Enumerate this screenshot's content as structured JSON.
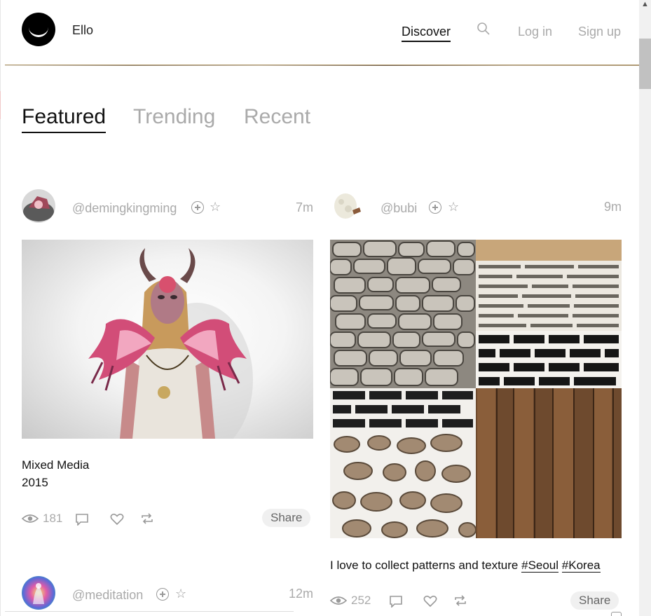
{
  "header": {
    "brand": "Ello",
    "nav": {
      "discover": "Discover",
      "login": "Log in",
      "signup": "Sign up"
    }
  },
  "tabs": [
    {
      "label": "Featured",
      "active": true
    },
    {
      "label": "Trending",
      "active": false
    },
    {
      "label": "Recent",
      "active": false
    }
  ],
  "posts": [
    {
      "username": "@demingkingming",
      "time": "7m",
      "text_lines": [
        "Mixed Media",
        "2015"
      ],
      "views": "181",
      "share": "Share"
    },
    {
      "username": "@bubi",
      "time": "9m",
      "text": "I love to collect patterns and texture",
      "tags": [
        "#Seoul",
        "#Korea"
      ],
      "views": "252",
      "share": "Share"
    },
    {
      "username": "@meditation",
      "time": "12m"
    }
  ],
  "colors": {
    "accent_line": "#b7a27a",
    "muted": "#aaaaaa",
    "text": "#111111"
  }
}
